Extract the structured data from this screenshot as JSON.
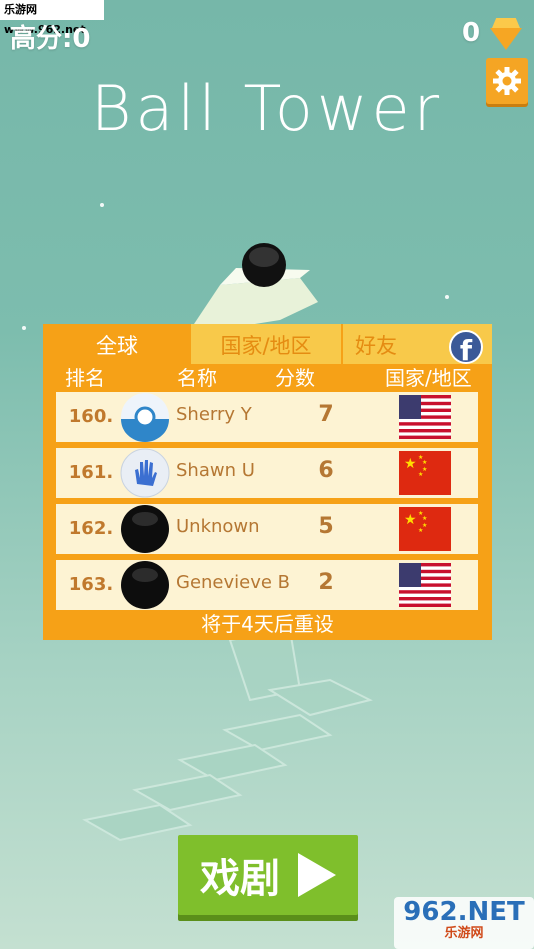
{
  "watermark_top": "乐游网 www.962.net",
  "hud": {
    "high_score_label": "高分:0",
    "gems": "0",
    "settings_icon": "gear-icon",
    "gem_icon": "diamond-icon"
  },
  "title": "Ball Tower",
  "leaderboard": {
    "tabs": [
      "全球",
      "国家/地区",
      "好友"
    ],
    "columns": [
      "排名",
      "名称",
      "分数",
      "国家/地区"
    ],
    "rows": [
      {
        "rank": "160.",
        "name": "Sherry Y",
        "score": "7",
        "avatar": "pokeball-avatar",
        "flag": "us-flag"
      },
      {
        "rank": "161.",
        "name": "Shawn U",
        "score": "6",
        "avatar": "hand-avatar",
        "flag": "cn-flag"
      },
      {
        "rank": "162.",
        "name": "Unknown",
        "score": "5",
        "avatar": "black-ball-avatar",
        "flag": "cn-flag"
      },
      {
        "rank": "163.",
        "name": "Genevieve B",
        "score": "2",
        "avatar": "black-ball-avatar",
        "flag": "us-flag"
      }
    ],
    "reset_text": "将于4天后重设"
  },
  "play_button": {
    "label": "戏剧"
  },
  "watermark_bottom": {
    "top": "962.NET",
    "bottom": "乐游网"
  },
  "colors": {
    "accent": "#f6a117",
    "play": "#7fbf2c",
    "row_bg": "#fdf3d3"
  }
}
